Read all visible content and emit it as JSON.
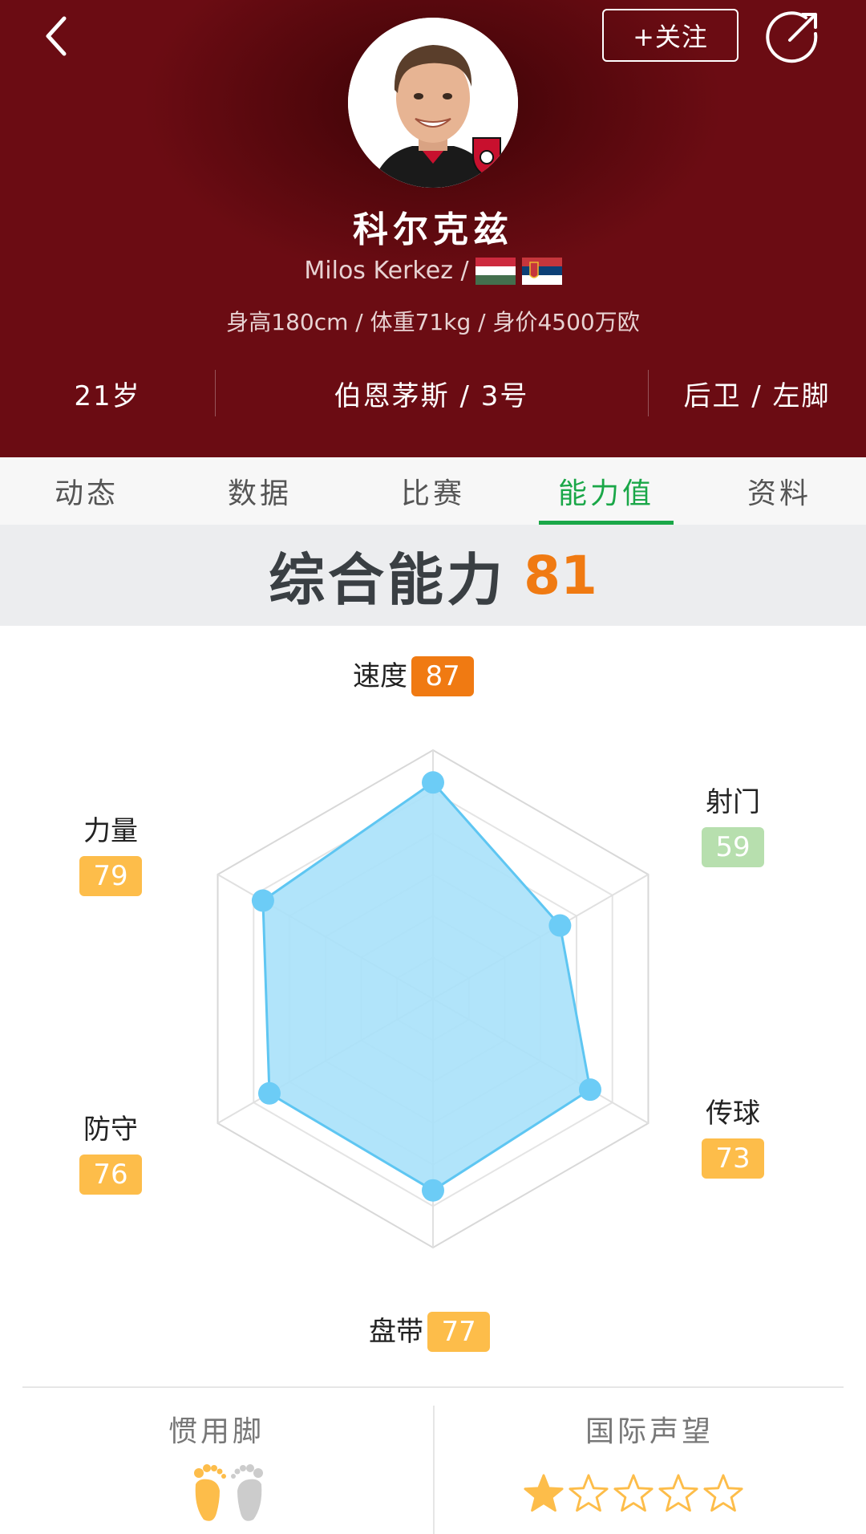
{
  "header": {
    "follow_label": "+关注",
    "player_name": "科尔克兹",
    "english_name": "Milos Kerkez /",
    "flags": [
      "hungary-flag",
      "serbia-flag"
    ],
    "bio": "身高180cm / 体重71kg / 身价4500万欧",
    "age": "21岁",
    "club_number": "伯恩茅斯 / 3号",
    "position_foot": "后卫 / 左脚"
  },
  "tabs": [
    {
      "label": "动态",
      "active": false
    },
    {
      "label": "数据",
      "active": false
    },
    {
      "label": "比赛",
      "active": false
    },
    {
      "label": "能力值",
      "active": true
    },
    {
      "label": "资料",
      "active": false
    }
  ],
  "overall": {
    "label": "综合能力",
    "value": "81"
  },
  "attributes": {
    "speed": {
      "label": "速度",
      "value": "87",
      "color": "#f07a12"
    },
    "shooting": {
      "label": "射门",
      "value": "59",
      "color": "#b7dfae"
    },
    "passing": {
      "label": "传球",
      "value": "73",
      "color": "#fdbd4a"
    },
    "dribbling": {
      "label": "盘带",
      "value": "77",
      "color": "#fdbd4a"
    },
    "defense": {
      "label": "防守",
      "value": "76",
      "color": "#fdbd4a"
    },
    "strength": {
      "label": "力量",
      "value": "79",
      "color": "#fdbd4a"
    }
  },
  "radar": {
    "order": [
      "speed",
      "shooting",
      "passing",
      "dribbling",
      "defense",
      "strength"
    ],
    "max": 100,
    "fill_color": "#a9e1fa",
    "stroke_color": "#5ec6f2",
    "point_color": "#6cccf6"
  },
  "bottom": {
    "preferred_foot_label": "惯用脚",
    "preferred_foot": "left",
    "reputation_label": "国际声望",
    "reputation_stars": 1,
    "reputation_max": 5
  },
  "icons": [
    "back-icon",
    "share-icon",
    "left-foot-icon",
    "right-foot-icon",
    "star-icon"
  ]
}
